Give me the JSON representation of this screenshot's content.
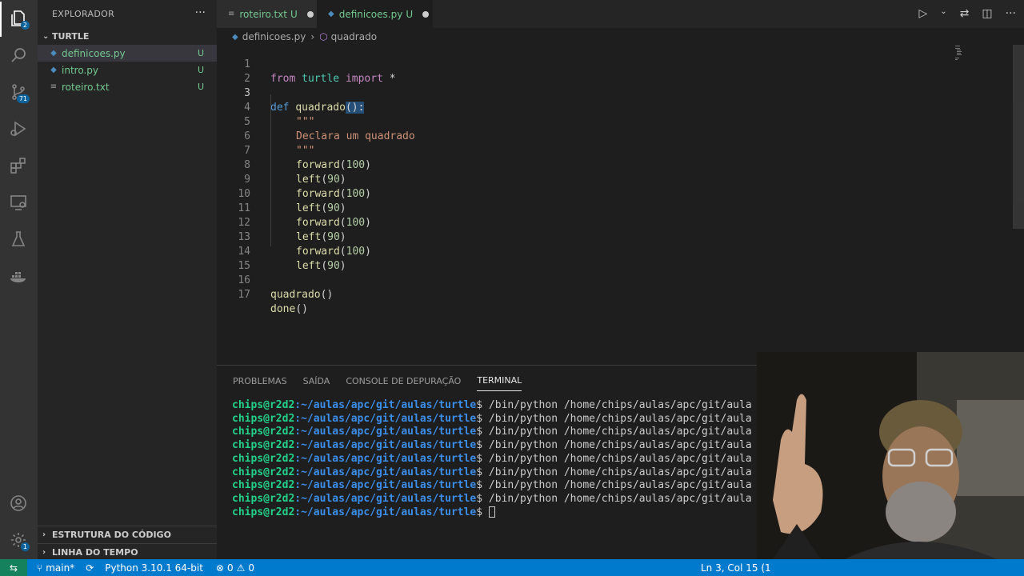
{
  "activity_bar": {
    "explorer_badge": "2",
    "scm_badge": "71",
    "settings_badge": "1"
  },
  "sidebar": {
    "title": "EXPLORADOR",
    "more": "···",
    "folder": "TURTLE",
    "files": [
      {
        "name": "definicoes.py",
        "status": "U"
      },
      {
        "name": "intro.py",
        "status": "U"
      },
      {
        "name": "roteiro.txt",
        "status": "U"
      }
    ],
    "outline": "ESTRUTURA DO CÓDIGO",
    "timeline": "LINHA DO TEMPO"
  },
  "tabs": [
    {
      "label": "roteiro.txt",
      "status": "U"
    },
    {
      "label": "definicoes.py",
      "status": "U"
    }
  ],
  "breadcrumb": {
    "file": "definicoes.py",
    "symbol": "quadrado"
  },
  "editor": {
    "line_numbers": [
      "1",
      "2",
      "3",
      "4",
      "5",
      "6",
      "7",
      "8",
      "9",
      "10",
      "11",
      "12",
      "13",
      "14",
      "15",
      "16",
      "17"
    ],
    "code": {
      "l1_from": "from",
      "l1_mod": "turtle",
      "l1_import": "import",
      "l1_star": "*",
      "l3_def": "def",
      "l3_name": "quadrado",
      "l3_rest": "():",
      "doc_quote": "\"\"\"",
      "doc_text": "Declara um quadrado",
      "forward": "forward",
      "left": "left",
      "n100": "100",
      "n90": "90",
      "call_quadrado": "quadrado",
      "call_done": "done",
      "parens": "()"
    }
  },
  "panel": {
    "tabs": [
      "PROBLEMAS",
      "SAÍDA",
      "CONSOLE DE DEPURAÇÃO",
      "TERMINAL"
    ],
    "terminal": {
      "user": "chips@r2d2",
      "path": ":~/aulas/apc/git/aulas/turtle",
      "prompt": "$ ",
      "command": "/bin/python /home/chips/aulas/apc/git/aula",
      "command_count": 8
    }
  },
  "statusbar": {
    "branch": "main*",
    "python": "Python 3.10.1 64-bit",
    "errors": "0",
    "warnings": "0",
    "position": "Ln 3, Col 15 (1"
  },
  "colors": {
    "accent": "#007acc",
    "untracked": "#73c991",
    "terminal_user": "#23d18b",
    "terminal_path": "#3b8eea"
  }
}
